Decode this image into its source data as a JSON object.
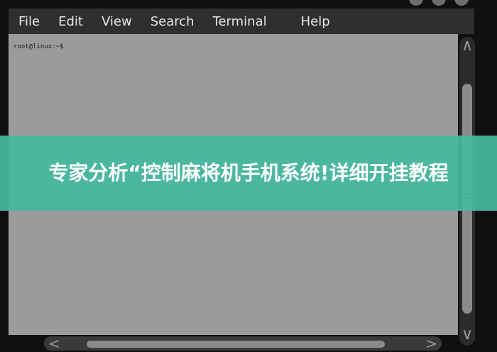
{
  "menubar": {
    "items": [
      "File",
      "Edit",
      "View",
      "Search",
      "Terminal",
      "Help"
    ]
  },
  "terminal": {
    "prompt": "root@linux:~$"
  },
  "scrollbar": {
    "up_icon": "chevron-up-icon",
    "down_icon": "chevron-down-icon",
    "left_icon": "chevron-left-icon",
    "right_icon": "chevron-right-icon"
  },
  "banner": {
    "text": "专家分析“控制麻将机手机系统!详细开挂教程",
    "color": "#45b99e"
  }
}
